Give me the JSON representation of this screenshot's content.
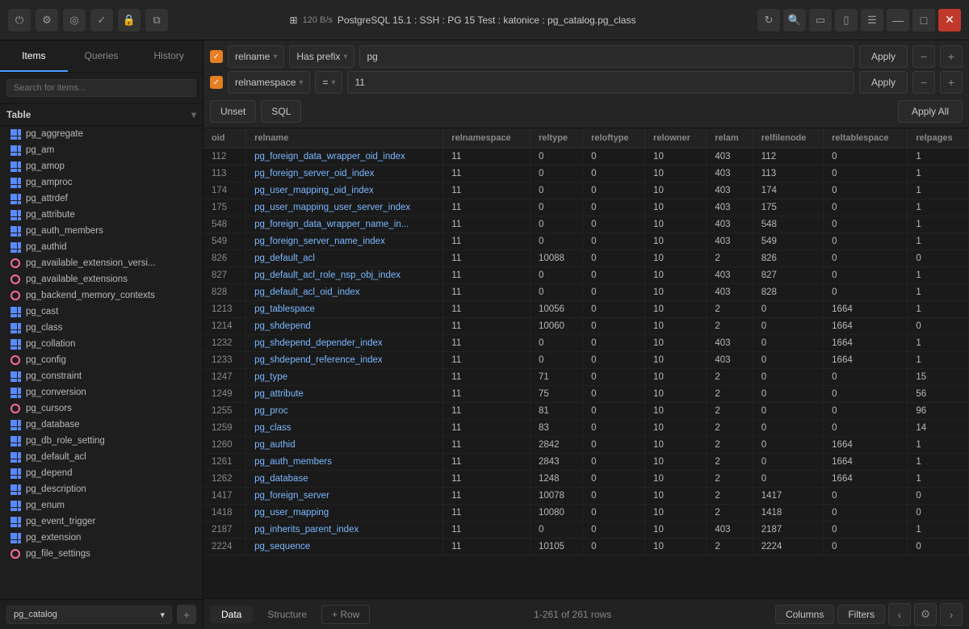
{
  "titleBar": {
    "rate": "120 B/s",
    "connection": "PostgreSQL 15.1 : SSH : PG 15 Test : katonice : pg_catalog.pg_class"
  },
  "sidebar": {
    "tabs": [
      "Items",
      "Queries",
      "History"
    ],
    "activeTab": "Items",
    "searchPlaceholder": "Search for items...",
    "sectionLabel": "Table",
    "items": [
      {
        "name": "pg_aggregate",
        "type": "table"
      },
      {
        "name": "pg_am",
        "type": "table"
      },
      {
        "name": "pg_amop",
        "type": "table"
      },
      {
        "name": "pg_amproc",
        "type": "table"
      },
      {
        "name": "pg_attrdef",
        "type": "table"
      },
      {
        "name": "pg_attribute",
        "type": "table"
      },
      {
        "name": "pg_auth_members",
        "type": "table"
      },
      {
        "name": "pg_authid",
        "type": "table"
      },
      {
        "name": "pg_available_extension_versi...",
        "type": "view"
      },
      {
        "name": "pg_available_extensions",
        "type": "view"
      },
      {
        "name": "pg_backend_memory_contexts",
        "type": "view"
      },
      {
        "name": "pg_cast",
        "type": "table"
      },
      {
        "name": "pg_class",
        "type": "table"
      },
      {
        "name": "pg_collation",
        "type": "table"
      },
      {
        "name": "pg_config",
        "type": "view"
      },
      {
        "name": "pg_constraint",
        "type": "table"
      },
      {
        "name": "pg_conversion",
        "type": "table"
      },
      {
        "name": "pg_cursors",
        "type": "view"
      },
      {
        "name": "pg_database",
        "type": "table"
      },
      {
        "name": "pg_db_role_setting",
        "type": "table"
      },
      {
        "name": "pg_default_acl",
        "type": "table"
      },
      {
        "name": "pg_depend",
        "type": "table"
      },
      {
        "name": "pg_description",
        "type": "table"
      },
      {
        "name": "pg_enum",
        "type": "table"
      },
      {
        "name": "pg_event_trigger",
        "type": "table"
      },
      {
        "name": "pg_extension",
        "type": "table"
      },
      {
        "name": "pg_file_settings",
        "type": "view"
      }
    ],
    "bottomDb": "pg_catalog",
    "addLabel": "+"
  },
  "filters": {
    "row1": {
      "field": "relname",
      "operator": "Has prefix",
      "value": "pg",
      "applyLabel": "Apply"
    },
    "row2": {
      "field": "relnamespace",
      "operator": "=",
      "value": "11",
      "applyLabel": "Apply"
    },
    "unsetLabel": "Unset",
    "sqlLabel": "SQL",
    "applyAllLabel": "Apply All"
  },
  "table": {
    "columns": [
      "oid",
      "relname",
      "relnamespace",
      "reltype",
      "reloftype",
      "relowner",
      "relam",
      "relfilenode",
      "reltablespace",
      "relpages"
    ],
    "rows": [
      {
        "oid": "112",
        "relname": "pg_foreign_data_wrapper_oid_index",
        "relnamespace": "11",
        "reltype": "0",
        "reloftype": "0",
        "relowner": "10",
        "relam": "403",
        "relfilenode": "112",
        "reltablespace": "0",
        "relpages": "1"
      },
      {
        "oid": "113",
        "relname": "pg_foreign_server_oid_index",
        "relnamespace": "11",
        "reltype": "0",
        "reloftype": "0",
        "relowner": "10",
        "relam": "403",
        "relfilenode": "113",
        "reltablespace": "0",
        "relpages": "1"
      },
      {
        "oid": "174",
        "relname": "pg_user_mapping_oid_index",
        "relnamespace": "11",
        "reltype": "0",
        "reloftype": "0",
        "relowner": "10",
        "relam": "403",
        "relfilenode": "174",
        "reltablespace": "0",
        "relpages": "1"
      },
      {
        "oid": "175",
        "relname": "pg_user_mapping_user_server_index",
        "relnamespace": "11",
        "reltype": "0",
        "reloftype": "0",
        "relowner": "10",
        "relam": "403",
        "relfilenode": "175",
        "reltablespace": "0",
        "relpages": "1"
      },
      {
        "oid": "548",
        "relname": "pg_foreign_data_wrapper_name_in...",
        "relnamespace": "11",
        "reltype": "0",
        "reloftype": "0",
        "relowner": "10",
        "relam": "403",
        "relfilenode": "548",
        "reltablespace": "0",
        "relpages": "1"
      },
      {
        "oid": "549",
        "relname": "pg_foreign_server_name_index",
        "relnamespace": "11",
        "reltype": "0",
        "reloftype": "0",
        "relowner": "10",
        "relam": "403",
        "relfilenode": "549",
        "reltablespace": "0",
        "relpages": "1"
      },
      {
        "oid": "826",
        "relname": "pg_default_acl",
        "relnamespace": "11",
        "reltype": "10088",
        "reloftype": "0",
        "relowner": "10",
        "relam": "2",
        "relfilenode": "826",
        "reltablespace": "0",
        "relpages": "0"
      },
      {
        "oid": "827",
        "relname": "pg_default_acl_role_nsp_obj_index",
        "relnamespace": "11",
        "reltype": "0",
        "reloftype": "0",
        "relowner": "10",
        "relam": "403",
        "relfilenode": "827",
        "reltablespace": "0",
        "relpages": "1"
      },
      {
        "oid": "828",
        "relname": "pg_default_acl_oid_index",
        "relnamespace": "11",
        "reltype": "0",
        "reloftype": "0",
        "relowner": "10",
        "relam": "403",
        "relfilenode": "828",
        "reltablespace": "0",
        "relpages": "1"
      },
      {
        "oid": "1213",
        "relname": "pg_tablespace",
        "relnamespace": "11",
        "reltype": "10056",
        "reloftype": "0",
        "relowner": "10",
        "relam": "2",
        "relfilenode": "0",
        "reltablespace": "1664",
        "relpages": "1"
      },
      {
        "oid": "1214",
        "relname": "pg_shdepend",
        "relnamespace": "11",
        "reltype": "10060",
        "reloftype": "0",
        "relowner": "10",
        "relam": "2",
        "relfilenode": "0",
        "reltablespace": "1664",
        "relpages": "0"
      },
      {
        "oid": "1232",
        "relname": "pg_shdepend_depender_index",
        "relnamespace": "11",
        "reltype": "0",
        "reloftype": "0",
        "relowner": "10",
        "relam": "403",
        "relfilenode": "0",
        "reltablespace": "1664",
        "relpages": "1"
      },
      {
        "oid": "1233",
        "relname": "pg_shdepend_reference_index",
        "relnamespace": "11",
        "reltype": "0",
        "reloftype": "0",
        "relowner": "10",
        "relam": "403",
        "relfilenode": "0",
        "reltablespace": "1664",
        "relpages": "1"
      },
      {
        "oid": "1247",
        "relname": "pg_type",
        "relnamespace": "11",
        "reltype": "71",
        "reloftype": "0",
        "relowner": "10",
        "relam": "2",
        "relfilenode": "0",
        "reltablespace": "0",
        "relpages": "15"
      },
      {
        "oid": "1249",
        "relname": "pg_attribute",
        "relnamespace": "11",
        "reltype": "75",
        "reloftype": "0",
        "relowner": "10",
        "relam": "2",
        "relfilenode": "0",
        "reltablespace": "0",
        "relpages": "56"
      },
      {
        "oid": "1255",
        "relname": "pg_proc",
        "relnamespace": "11",
        "reltype": "81",
        "reloftype": "0",
        "relowner": "10",
        "relam": "2",
        "relfilenode": "0",
        "reltablespace": "0",
        "relpages": "96"
      },
      {
        "oid": "1259",
        "relname": "pg_class",
        "relnamespace": "11",
        "reltype": "83",
        "reloftype": "0",
        "relowner": "10",
        "relam": "2",
        "relfilenode": "0",
        "reltablespace": "0",
        "relpages": "14"
      },
      {
        "oid": "1260",
        "relname": "pg_authid",
        "relnamespace": "11",
        "reltype": "2842",
        "reloftype": "0",
        "relowner": "10",
        "relam": "2",
        "relfilenode": "0",
        "reltablespace": "1664",
        "relpages": "1"
      },
      {
        "oid": "1261",
        "relname": "pg_auth_members",
        "relnamespace": "11",
        "reltype": "2843",
        "reloftype": "0",
        "relowner": "10",
        "relam": "2",
        "relfilenode": "0",
        "reltablespace": "1664",
        "relpages": "1"
      },
      {
        "oid": "1262",
        "relname": "pg_database",
        "relnamespace": "11",
        "reltype": "1248",
        "reloftype": "0",
        "relowner": "10",
        "relam": "2",
        "relfilenode": "0",
        "reltablespace": "1664",
        "relpages": "1"
      },
      {
        "oid": "1417",
        "relname": "pg_foreign_server",
        "relnamespace": "11",
        "reltype": "10078",
        "reloftype": "0",
        "relowner": "10",
        "relam": "2",
        "relfilenode": "1417",
        "reltablespace": "0",
        "relpages": "0"
      },
      {
        "oid": "1418",
        "relname": "pg_user_mapping",
        "relnamespace": "11",
        "reltype": "10080",
        "reloftype": "0",
        "relowner": "10",
        "relam": "2",
        "relfilenode": "1418",
        "reltablespace": "0",
        "relpages": "0"
      },
      {
        "oid": "2187",
        "relname": "pg_inherits_parent_index",
        "relnamespace": "11",
        "reltype": "0",
        "reloftype": "0",
        "relowner": "10",
        "relam": "403",
        "relfilenode": "2187",
        "reltablespace": "0",
        "relpages": "1"
      },
      {
        "oid": "2224",
        "relname": "pg_sequence",
        "relnamespace": "11",
        "reltype": "10105",
        "reloftype": "0",
        "relowner": "10",
        "relam": "2",
        "relfilenode": "2224",
        "reltablespace": "0",
        "relpages": "0"
      }
    ],
    "rowCount": "1-261 of 261 rows"
  },
  "bottomBar": {
    "tabs": [
      "Data",
      "Structure"
    ],
    "activeTab": "Data",
    "addRowLabel": "+ Row",
    "columnsLabel": "Columns",
    "filtersLabel": "Filters"
  }
}
